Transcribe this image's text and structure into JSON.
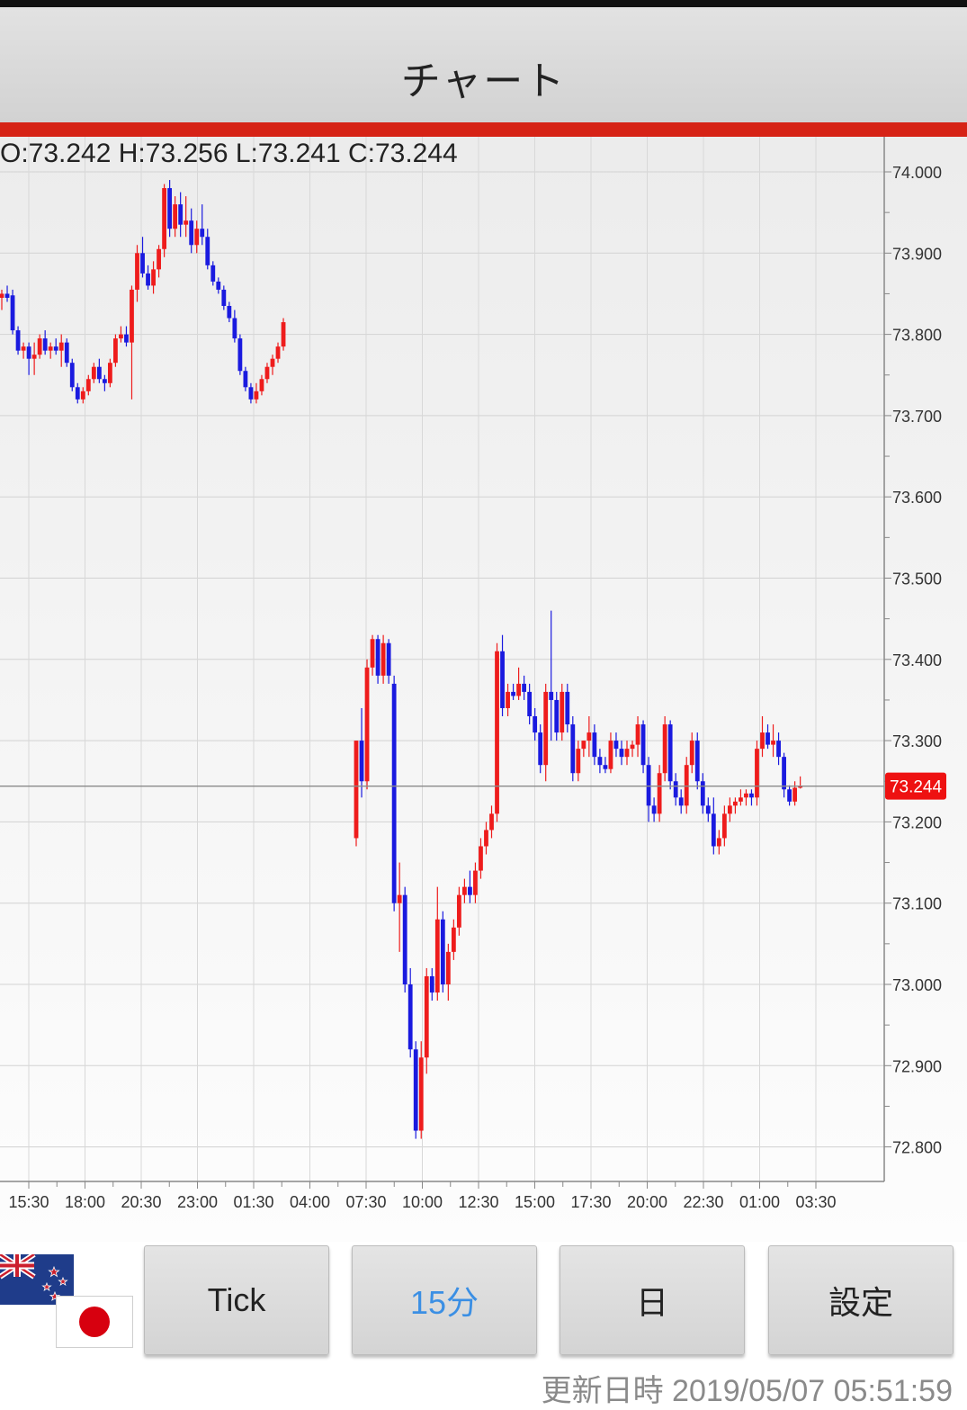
{
  "header": {
    "title": "チャート"
  },
  "ohlc": {
    "text": "O:73.242 H:73.256 L:73.241 C:73.244"
  },
  "chart_data": {
    "type": "candlestick",
    "y_ticks": [
      "74.000",
      "73.900",
      "73.800",
      "73.700",
      "73.600",
      "73.500",
      "73.400",
      "73.300",
      "73.200",
      "73.100",
      "73.000",
      "72.900",
      "72.800"
    ],
    "x_ticks": [
      "15:30",
      "18:00",
      "20:30",
      "23:00",
      "01:30",
      "04:00",
      "07:30",
      "10:00",
      "12:30",
      "15:00",
      "17:30",
      "20:00",
      "22:30",
      "01:00",
      "03:30"
    ],
    "ylim": [
      72.77,
      74.03
    ],
    "current_price": "73.244",
    "current_value": 73.244,
    "up_color": "#ee1c1c",
    "down_color": "#1a1adf",
    "segments": [
      {
        "candles": [
          [
            73.845,
            73.855,
            73.83,
            73.85
          ],
          [
            73.85,
            73.86,
            73.84,
            73.845
          ],
          [
            73.848,
            73.855,
            73.8,
            73.805
          ],
          [
            73.805,
            73.81,
            73.775,
            73.78
          ],
          [
            73.78,
            73.79,
            73.77,
            73.785
          ],
          [
            73.785,
            73.79,
            73.75,
            73.77
          ],
          [
            73.77,
            73.79,
            73.75,
            73.775
          ],
          [
            73.775,
            73.8,
            73.77,
            73.795
          ],
          [
            73.795,
            73.805,
            73.775,
            73.78
          ],
          [
            73.78,
            73.79,
            73.77,
            73.785
          ],
          [
            73.785,
            73.795,
            73.775,
            73.78
          ],
          [
            73.78,
            73.8,
            73.76,
            73.79
          ],
          [
            73.79,
            73.795,
            73.76,
            73.765
          ],
          [
            73.765,
            73.77,
            73.73,
            73.735
          ],
          [
            73.735,
            73.74,
            73.715,
            73.72
          ],
          [
            73.72,
            73.735,
            73.715,
            73.73
          ],
          [
            73.73,
            73.75,
            73.725,
            73.745
          ],
          [
            73.745,
            73.765,
            73.74,
            73.76
          ],
          [
            73.76,
            73.77,
            73.74,
            73.745
          ],
          [
            73.745,
            73.75,
            73.73,
            73.74
          ],
          [
            73.74,
            73.77,
            73.735,
            73.765
          ],
          [
            73.765,
            73.8,
            73.76,
            73.795
          ],
          [
            73.795,
            73.81,
            73.79,
            73.8
          ],
          [
            73.8,
            73.81,
            73.785,
            73.79
          ],
          [
            73.79,
            73.86,
            73.72,
            73.855
          ],
          [
            73.855,
            73.91,
            73.84,
            73.9
          ],
          [
            73.9,
            73.92,
            73.87,
            73.875
          ],
          [
            73.875,
            73.885,
            73.855,
            73.86
          ],
          [
            73.86,
            73.89,
            73.85,
            73.88
          ],
          [
            73.88,
            73.91,
            73.87,
            73.905
          ],
          [
            73.905,
            73.985,
            73.895,
            73.98
          ],
          [
            73.98,
            73.99,
            73.92,
            73.93
          ],
          [
            73.93,
            73.97,
            73.92,
            73.96
          ],
          [
            73.96,
            73.975,
            73.92,
            73.935
          ],
          [
            73.935,
            73.97,
            73.92,
            73.94
          ],
          [
            73.94,
            73.955,
            73.9,
            73.91
          ],
          [
            73.91,
            73.94,
            73.9,
            73.93
          ],
          [
            73.93,
            73.96,
            73.91,
            73.92
          ],
          [
            73.92,
            73.93,
            73.88,
            73.885
          ],
          [
            73.885,
            73.89,
            73.86,
            73.865
          ],
          [
            73.865,
            73.87,
            73.85,
            73.855
          ],
          [
            73.855,
            73.86,
            73.83,
            73.835
          ],
          [
            73.835,
            73.84,
            73.815,
            73.82
          ],
          [
            73.82,
            73.83,
            73.79,
            73.795
          ],
          [
            73.795,
            73.8,
            73.75,
            73.755
          ],
          [
            73.755,
            73.76,
            73.73,
            73.735
          ],
          [
            73.735,
            73.74,
            73.715,
            73.72
          ],
          [
            73.72,
            73.74,
            73.715,
            73.73
          ],
          [
            73.73,
            73.75,
            73.725,
            73.745
          ],
          [
            73.745,
            73.765,
            73.74,
            73.76
          ],
          [
            73.76,
            73.775,
            73.75,
            73.77
          ],
          [
            73.77,
            73.79,
            73.765,
            73.785
          ],
          [
            73.785,
            73.82,
            73.78,
            73.815
          ]
        ]
      },
      {
        "candles": [
          [
            73.18,
            73.3,
            73.17,
            73.3
          ],
          [
            73.3,
            73.34,
            73.23,
            73.25
          ],
          [
            73.25,
            73.4,
            73.24,
            73.39
          ],
          [
            73.39,
            73.43,
            73.38,
            73.425
          ],
          [
            73.425,
            73.43,
            73.37,
            73.38
          ],
          [
            73.38,
            73.43,
            73.37,
            73.42
          ],
          [
            73.42,
            73.425,
            73.37,
            73.38
          ],
          [
            73.37,
            73.38,
            73.09,
            73.1
          ],
          [
            73.1,
            73.15,
            73.04,
            73.11
          ],
          [
            73.11,
            73.12,
            72.99,
            73.0
          ],
          [
            73.0,
            73.02,
            72.91,
            72.92
          ],
          [
            72.92,
            72.93,
            72.81,
            72.82
          ],
          [
            72.82,
            72.93,
            72.81,
            72.91
          ],
          [
            72.91,
            73.02,
            72.89,
            73.01
          ],
          [
            73.01,
            73.02,
            72.98,
            72.99
          ],
          [
            72.99,
            73.12,
            72.98,
            73.08
          ],
          [
            73.08,
            73.09,
            72.99,
            73.0
          ],
          [
            73.0,
            73.05,
            72.98,
            73.04
          ],
          [
            73.04,
            73.08,
            73.03,
            73.07
          ],
          [
            73.07,
            73.12,
            73.06,
            73.11
          ],
          [
            73.11,
            73.13,
            73.1,
            73.12
          ],
          [
            73.12,
            73.14,
            73.1,
            73.11
          ],
          [
            73.11,
            73.15,
            73.1,
            73.14
          ],
          [
            73.14,
            73.18,
            73.13,
            73.17
          ],
          [
            73.17,
            73.2,
            73.16,
            73.19
          ],
          [
            73.19,
            73.22,
            73.18,
            73.21
          ],
          [
            73.21,
            73.42,
            73.2,
            73.41
          ],
          [
            73.41,
            73.43,
            73.33,
            73.34
          ],
          [
            73.34,
            73.37,
            73.33,
            73.36
          ],
          [
            73.36,
            73.37,
            73.35,
            73.355
          ],
          [
            73.355,
            73.39,
            73.35,
            73.37
          ],
          [
            73.37,
            73.38,
            73.35,
            73.36
          ],
          [
            73.36,
            73.37,
            73.32,
            73.33
          ],
          [
            73.33,
            73.34,
            73.3,
            73.31
          ],
          [
            73.31,
            73.32,
            73.26,
            73.27
          ],
          [
            73.27,
            73.37,
            73.25,
            73.36
          ],
          [
            73.36,
            73.46,
            73.3,
            73.35
          ],
          [
            73.35,
            73.36,
            73.3,
            73.31
          ],
          [
            73.31,
            73.37,
            73.3,
            73.36
          ],
          [
            73.36,
            73.37,
            73.31,
            73.32
          ],
          [
            73.32,
            73.33,
            73.25,
            73.26
          ],
          [
            73.26,
            73.3,
            73.25,
            73.29
          ],
          [
            73.29,
            73.3,
            73.28,
            73.3
          ],
          [
            73.3,
            73.33,
            73.28,
            73.31
          ],
          [
            73.31,
            73.32,
            73.27,
            73.28
          ],
          [
            73.28,
            73.29,
            73.26,
            73.27
          ],
          [
            73.27,
            73.28,
            73.26,
            73.265
          ],
          [
            73.265,
            73.31,
            73.26,
            73.3
          ],
          [
            73.3,
            73.31,
            73.28,
            73.29
          ],
          [
            73.29,
            73.3,
            73.27,
            73.28
          ],
          [
            73.28,
            73.3,
            73.27,
            73.29
          ],
          [
            73.29,
            73.3,
            73.28,
            73.295
          ],
          [
            73.295,
            73.33,
            73.28,
            73.32
          ],
          [
            73.32,
            73.325,
            73.26,
            73.27
          ],
          [
            73.27,
            73.28,
            73.2,
            73.22
          ],
          [
            73.22,
            73.23,
            73.2,
            73.21
          ],
          [
            73.21,
            73.27,
            73.2,
            73.26
          ],
          [
            73.26,
            73.33,
            73.25,
            73.32
          ],
          [
            73.32,
            73.325,
            73.24,
            73.25
          ],
          [
            73.25,
            73.26,
            73.22,
            73.23
          ],
          [
            73.23,
            73.24,
            73.21,
            73.22
          ],
          [
            73.22,
            73.28,
            73.21,
            73.27
          ],
          [
            73.27,
            73.31,
            73.26,
            73.3
          ],
          [
            73.3,
            73.31,
            73.24,
            73.25
          ],
          [
            73.25,
            73.26,
            73.21,
            73.22
          ],
          [
            73.22,
            73.23,
            73.2,
            73.21
          ],
          [
            73.21,
            73.23,
            73.16,
            73.17
          ],
          [
            73.17,
            73.19,
            73.16,
            73.18
          ],
          [
            73.18,
            73.22,
            73.17,
            73.21
          ],
          [
            73.21,
            73.23,
            73.2,
            73.22
          ],
          [
            73.22,
            73.23,
            73.21,
            73.225
          ],
          [
            73.225,
            73.24,
            73.22,
            73.23
          ],
          [
            73.23,
            73.24,
            73.22,
            73.235
          ],
          [
            73.235,
            73.24,
            73.22,
            73.23
          ],
          [
            73.23,
            73.3,
            73.22,
            73.29
          ],
          [
            73.29,
            73.33,
            73.28,
            73.31
          ],
          [
            73.31,
            73.32,
            73.29,
            73.295
          ],
          [
            73.295,
            73.32,
            73.28,
            73.3
          ],
          [
            73.3,
            73.31,
            73.27,
            73.28
          ],
          [
            73.28,
            73.285,
            73.23,
            73.24
          ],
          [
            73.24,
            73.245,
            73.22,
            73.225
          ],
          [
            73.225,
            73.25,
            73.22,
            73.242
          ],
          [
            73.242,
            73.256,
            73.241,
            73.244
          ]
        ]
      }
    ]
  },
  "controls": {
    "buttons": [
      {
        "label": "Tick",
        "active": false
      },
      {
        "label": "15分",
        "active": true
      },
      {
        "label": "日",
        "active": false
      },
      {
        "label": "設定",
        "active": false
      }
    ],
    "updated": "更新日時 2019/05/07 05:51:59"
  }
}
